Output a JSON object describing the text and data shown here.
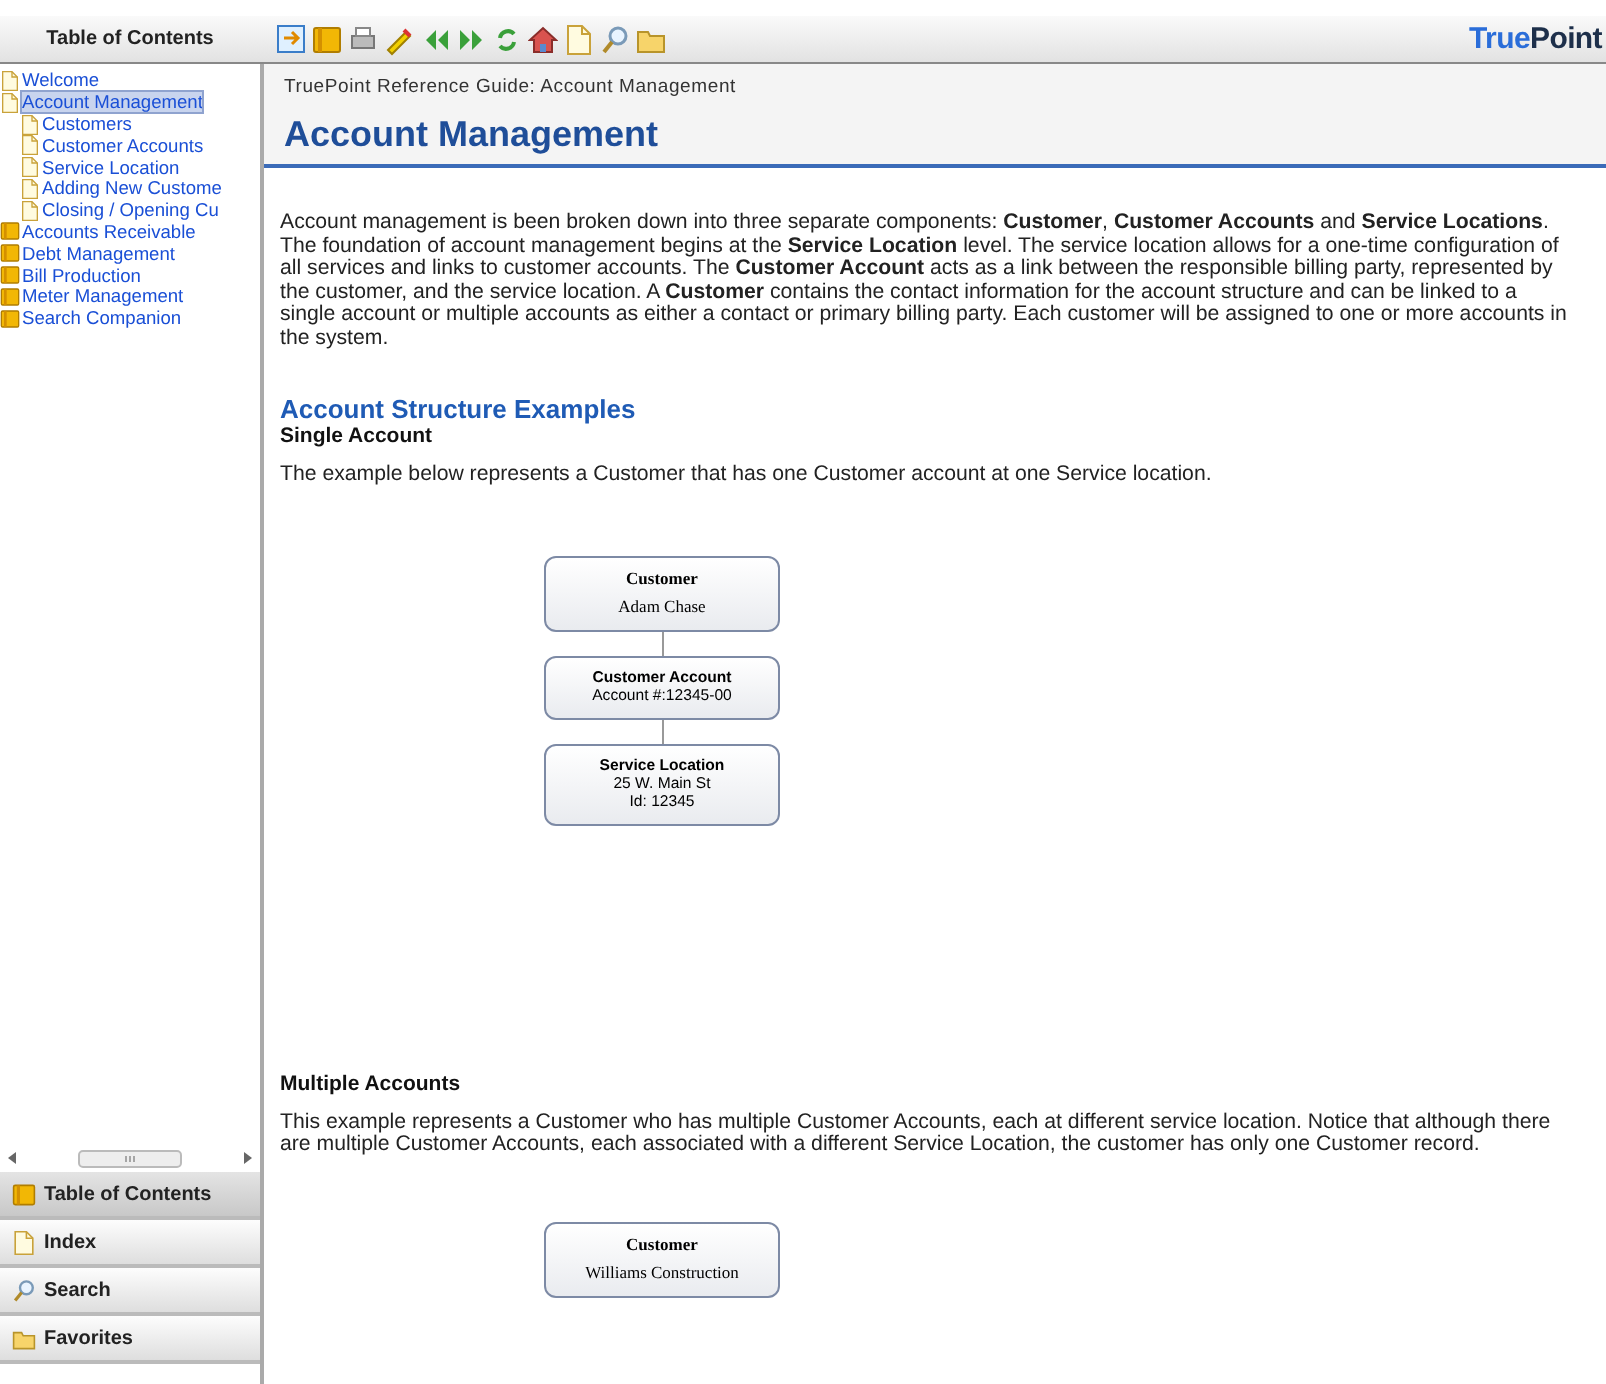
{
  "sidebar": {
    "title": "Table of Contents",
    "tree": [
      {
        "label": "Welcome",
        "kind": "page",
        "selected": false
      },
      {
        "label": "Account Management",
        "kind": "page",
        "selected": true,
        "children": [
          {
            "label": "Customers",
            "kind": "page",
            "selected": false
          },
          {
            "label": "Customer Accounts",
            "kind": "page",
            "selected": false
          },
          {
            "label": "Service Location",
            "kind": "page",
            "selected": false
          },
          {
            "label": "Adding New Custome",
            "kind": "page",
            "selected": false
          },
          {
            "label": "Closing / Opening Cu",
            "kind": "page",
            "selected": false
          }
        ]
      },
      {
        "label": "Accounts Receivable",
        "kind": "book",
        "selected": false
      },
      {
        "label": "Debt Management",
        "kind": "book",
        "selected": false
      },
      {
        "label": "Bill Production",
        "kind": "book",
        "selected": false
      },
      {
        "label": "Meter Management",
        "kind": "book",
        "selected": false
      },
      {
        "label": "Search Companion",
        "kind": "book",
        "selected": false
      }
    ],
    "tabs": [
      {
        "label": "Table of Contents",
        "kind": "book",
        "selected": true
      },
      {
        "label": "Index",
        "kind": "page",
        "selected": false
      },
      {
        "label": "Search",
        "kind": "search",
        "selected": false
      },
      {
        "label": "Favorites",
        "kind": "folder",
        "selected": false
      }
    ]
  },
  "logo": {
    "parts": [
      "True",
      "Point"
    ]
  },
  "content": {
    "breadcrumb": "TruePoint Reference Guide: Account Management",
    "title": "Account Management",
    "intro": "Account management is been broken down into three separate components: **Customer**, **Customer Accounts** and **Service Locations**. The foundation of account management begins at the **Service Location** level. The service location allows for a one-time configuration of all services and links to customer accounts.  The **Customer Account** acts as a link between the responsible billing party, represented by the customer, and the service location. A **Customer** contains the contact information for the account structure and can be linked to a single account or multiple accounts as either a contact or primary billing party. Each customer will be assigned to one or more accounts in the system.",
    "section_title": "Account Structure Examples",
    "examples": [
      {
        "title": "Single Account",
        "text": "The example below represents a Customer that has one Customer account at one Service location.",
        "nodes": [
          {
            "kind": "serif",
            "name": "Customer",
            "lines": [
              "Adam Chase"
            ]
          },
          {
            "kind": "sans",
            "name": "Customer Account",
            "lines": [
              "Account #:12345-00"
            ]
          },
          {
            "kind": "sans",
            "name": "Service Location",
            "lines": [
              "25 W. Main St",
              "Id: 12345"
            ]
          }
        ]
      },
      {
        "title": "Multiple Accounts",
        "text": "This example represents a Customer who has multiple Customer Accounts, each at different service location. Notice that although there are multiple Customer Accounts, each associated with a different Service Location, the customer has only one Customer record.",
        "nodes": [
          {
            "kind": "serif",
            "name": "Customer",
            "lines": [
              "Williams Construction"
            ]
          }
        ]
      }
    ]
  }
}
